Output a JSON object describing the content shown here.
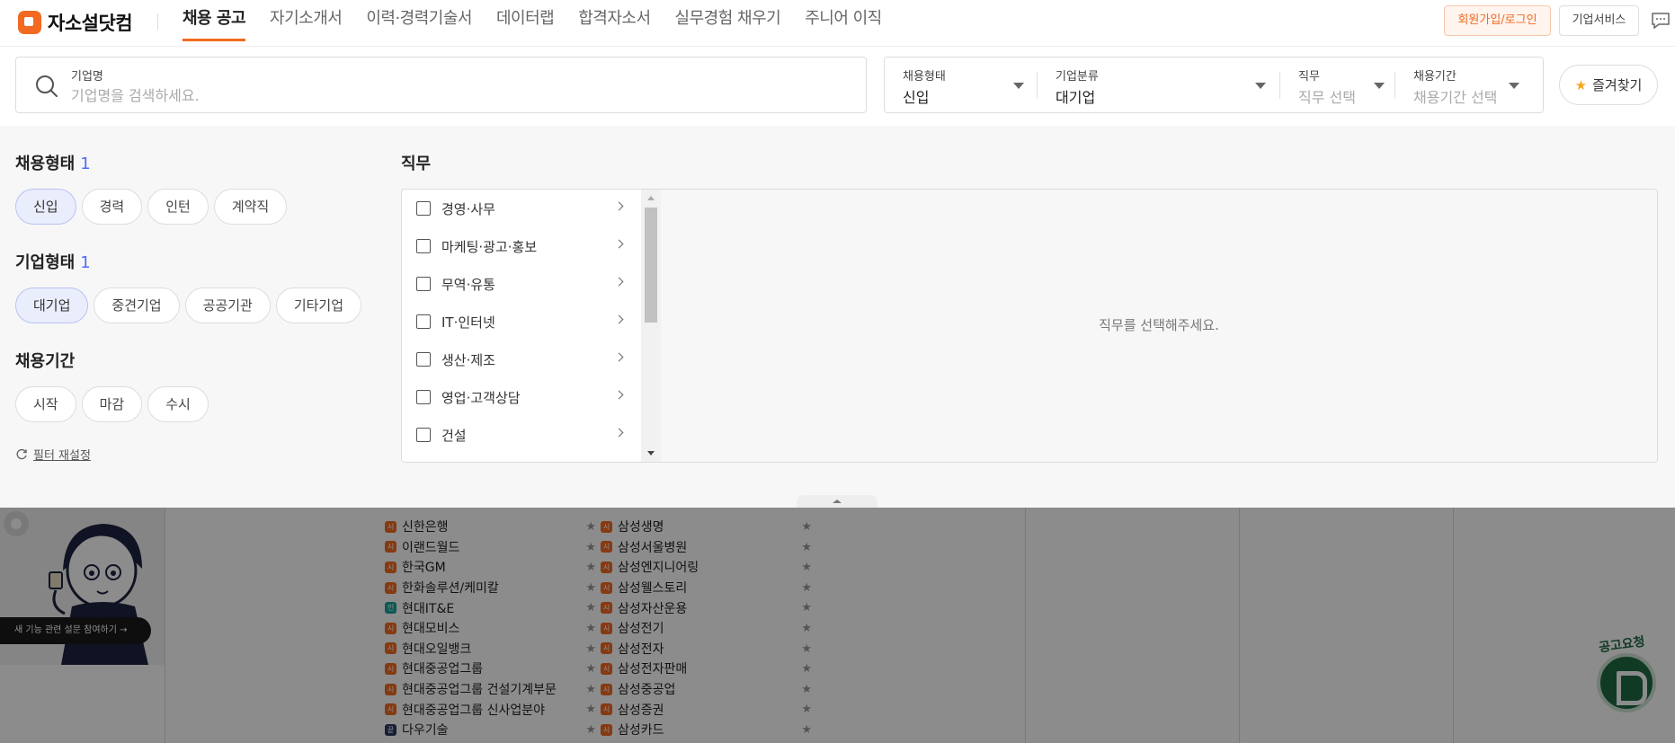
{
  "brand": {
    "name": "자소설닷컴",
    "accent": "#f26a21"
  },
  "nav": {
    "items": [
      "채용 공고",
      "자기소개서",
      "이력·경력기술서",
      "데이터랩",
      "합격자소서",
      "실무경험 채우기",
      "주니어 이직"
    ],
    "active": "채용 공고"
  },
  "header_actions": {
    "login": "회원가입/로그인",
    "business": "기업서비스",
    "chat_icon": "chat-bubble-icon"
  },
  "search": {
    "label": "기업명",
    "placeholder": "기업명을 검색하세요.",
    "value": "",
    "icon": "search-icon"
  },
  "filters": {
    "employment_type": {
      "label": "채용형태",
      "value": "신입"
    },
    "company_class": {
      "label": "기업분류",
      "value": "대기업"
    },
    "job": {
      "label": "직무",
      "placeholder": "직무 선택"
    },
    "period": {
      "label": "채용기간",
      "placeholder": "채용기간 선택"
    }
  },
  "favorites_button": {
    "label": "즐겨찾기",
    "icon": "star-icon",
    "icon_color": "#f5a623"
  },
  "panel": {
    "employment": {
      "title": "채용형태",
      "count": "1",
      "options": [
        "신입",
        "경력",
        "인턴",
        "계약직"
      ],
      "selected": "신입"
    },
    "company_type": {
      "title": "기업형태",
      "count": "1",
      "options": [
        "대기업",
        "중견기업",
        "공공기관",
        "기타기업"
      ],
      "selected": "대기업"
    },
    "period": {
      "title": "채용기간",
      "options": [
        "시작",
        "마감",
        "수시"
      ]
    },
    "reset": "필터 재설정",
    "job": {
      "title": "직무",
      "categories": [
        "경영·사무",
        "마케팅·광고·홍보",
        "무역·유통",
        "IT·인터넷",
        "생산·제조",
        "영업·고객상담",
        "건설"
      ],
      "empty_message": "직무를 선택해주세요."
    },
    "selected_chip_color": "#eaedfb",
    "count_color": "#4f6cf5"
  },
  "background": {
    "survey_button": "새 기능 관련 설문 참여하기 →",
    "column_left": [
      {
        "badge": "시",
        "name": "신한은행"
      },
      {
        "badge": "시",
        "name": "이랜드월드"
      },
      {
        "badge": "시",
        "name": "한국GM"
      },
      {
        "badge": "시",
        "name": "한화솔루션/케미칼"
      },
      {
        "badge": "인",
        "name": "현대IT&E"
      },
      {
        "badge": "시",
        "name": "현대모비스"
      },
      {
        "badge": "시",
        "name": "현대오일뱅크"
      },
      {
        "badge": "시",
        "name": "현대중공업그룹"
      },
      {
        "badge": "시",
        "name": "현대중공업그룹 건설기계부문"
      },
      {
        "badge": "시",
        "name": "현대중공업그룹 신사업분야"
      },
      {
        "badge": "끝",
        "name": "다우기술"
      }
    ],
    "column_right": [
      {
        "badge": "시",
        "name": "삼성생명"
      },
      {
        "badge": "시",
        "name": "삼성서울병원"
      },
      {
        "badge": "시",
        "name": "삼성엔지니어링"
      },
      {
        "badge": "시",
        "name": "삼성웰스토리"
      },
      {
        "badge": "시",
        "name": "삼성자산운용"
      },
      {
        "badge": "시",
        "name": "삼성전기"
      },
      {
        "badge": "시",
        "name": "삼성전자"
      },
      {
        "badge": "시",
        "name": "삼성전자판매"
      },
      {
        "badge": "시",
        "name": "삼성중공업"
      },
      {
        "badge": "시",
        "name": "삼성증권"
      },
      {
        "badge": "시",
        "name": "삼성카드"
      }
    ],
    "ad_label": "공고요청"
  }
}
